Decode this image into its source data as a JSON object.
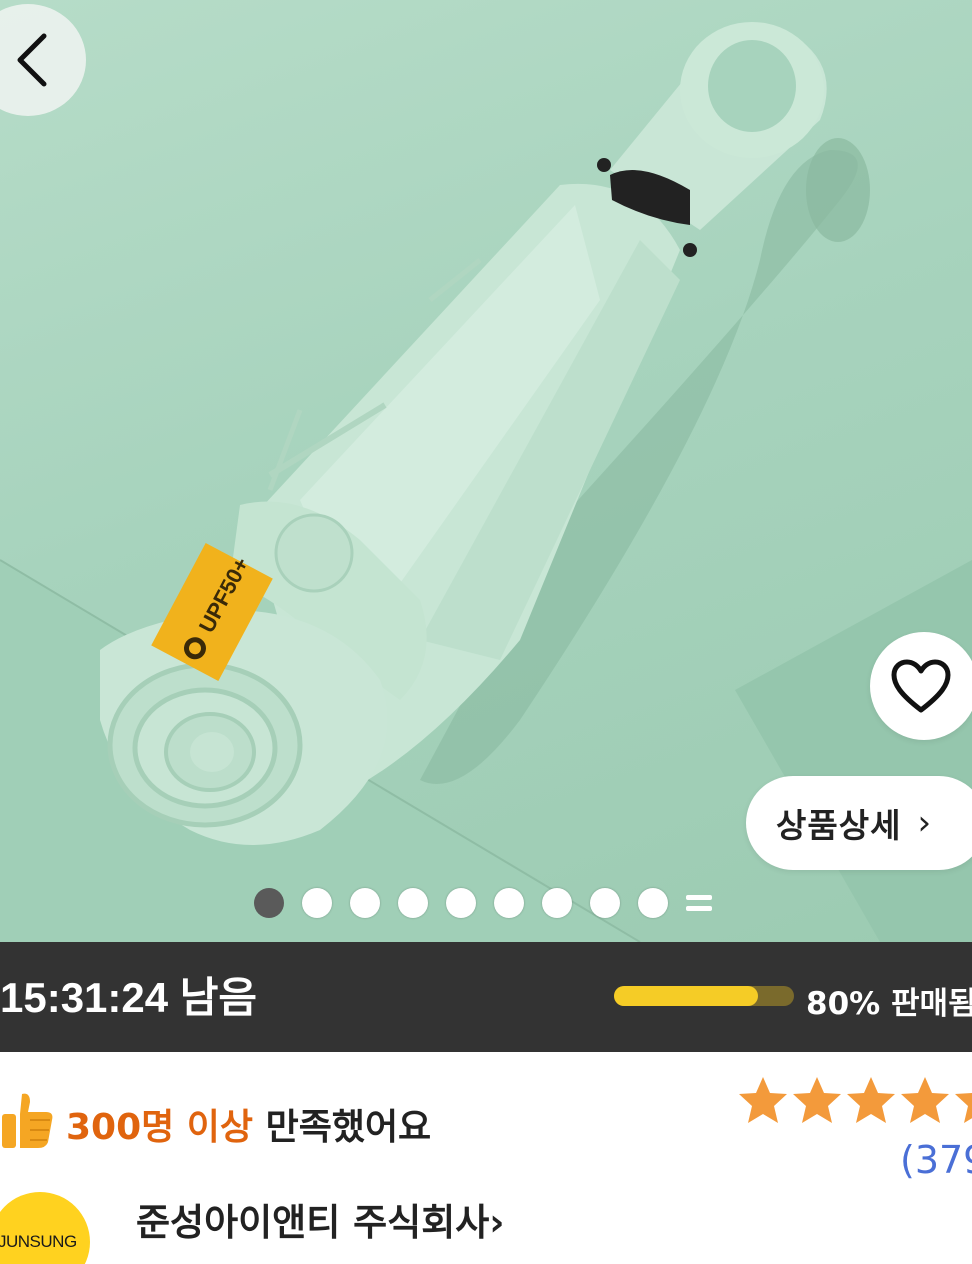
{
  "product_image": {
    "label_text": "UPF50+",
    "background_color": "#a7d3bd",
    "carousel": {
      "total_dots": 9,
      "active_index": 0
    }
  },
  "buttons": {
    "back_icon": "chevron-left-icon",
    "wishlist_icon": "heart-outline-icon",
    "detail_label": "상품상세",
    "detail_chevron": "›"
  },
  "deal": {
    "countdown": "15:31:24",
    "remaining_label": "남음",
    "sold_percent": 80,
    "sold_text": "80% 판매됨",
    "bar_color": "#f5cc26"
  },
  "satisfaction": {
    "icon": "thumbs-up-icon",
    "highlight": "300명 이상",
    "text": " 만족했어요",
    "highlight_color": "#e0640e"
  },
  "rating": {
    "stars": 5,
    "review_count_text": "(379"
  },
  "seller": {
    "logo_text": "JUNSUNG",
    "name": "준성아이앤티 주식회사",
    "chevron": "›"
  }
}
